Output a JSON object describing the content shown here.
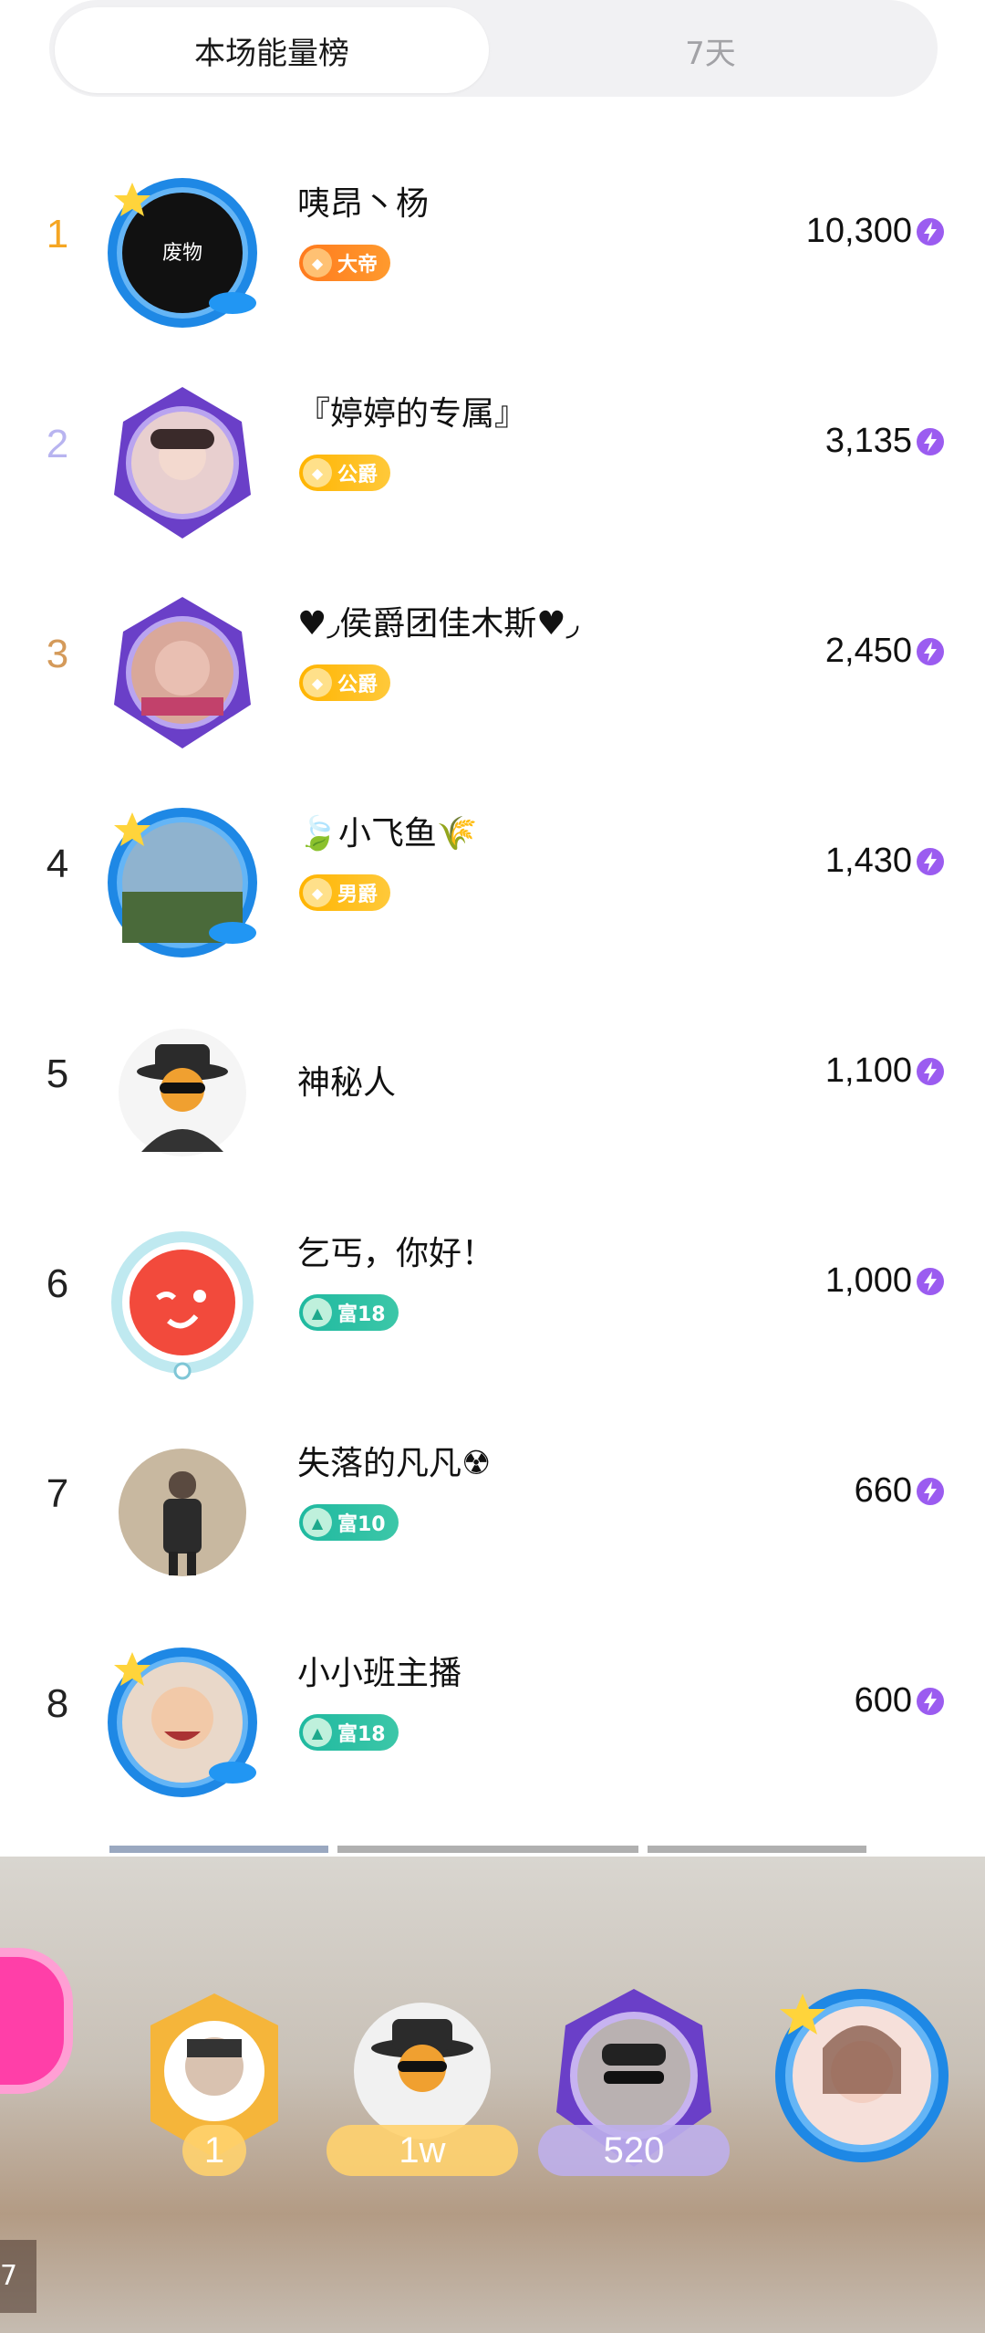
{
  "tabs": {
    "active": "本场能量榜",
    "inactive": "7天"
  },
  "colors": {
    "rank1": "#f5a623",
    "rank2": "#b8b4f0",
    "rank3": "#d49a5a",
    "energy": "#9b5cf0"
  },
  "rows": [
    {
      "rank": "1",
      "name": "咦昂丶杨",
      "badge": "大帝",
      "badge_style": "orange",
      "score": "10,300"
    },
    {
      "rank": "2",
      "name": "『婷婷的专属』",
      "badge": "公爵",
      "badge_style": "gold",
      "score": "3,135"
    },
    {
      "rank": "3",
      "name": "♥︎◞侯爵团佳木斯♥︎◞",
      "badge": "公爵",
      "badge_style": "gold",
      "score": "2,450"
    },
    {
      "rank": "4",
      "name": "🍃小飞鱼🌾",
      "badge": "男爵",
      "badge_style": "gold",
      "score": "1,430"
    },
    {
      "rank": "5",
      "name": "神秘人",
      "badge": "",
      "badge_style": "",
      "score": "1,100"
    },
    {
      "rank": "6",
      "name": "乞丐，你好！",
      "badge": "富18",
      "badge_style": "teal",
      "score": "1,000"
    },
    {
      "rank": "7",
      "name": "失落的凡凡☢",
      "badge": "富10",
      "badge_style": "teal",
      "score": "660"
    },
    {
      "rank": "8",
      "name": "小小班主播",
      "badge": "富18",
      "badge_style": "teal",
      "score": "600"
    }
  ],
  "bottom": {
    "items": [
      {
        "label": "1"
      },
      {
        "label": "1w"
      },
      {
        "label": "520"
      },
      {
        "label": ""
      }
    ],
    "side_number": "7"
  }
}
